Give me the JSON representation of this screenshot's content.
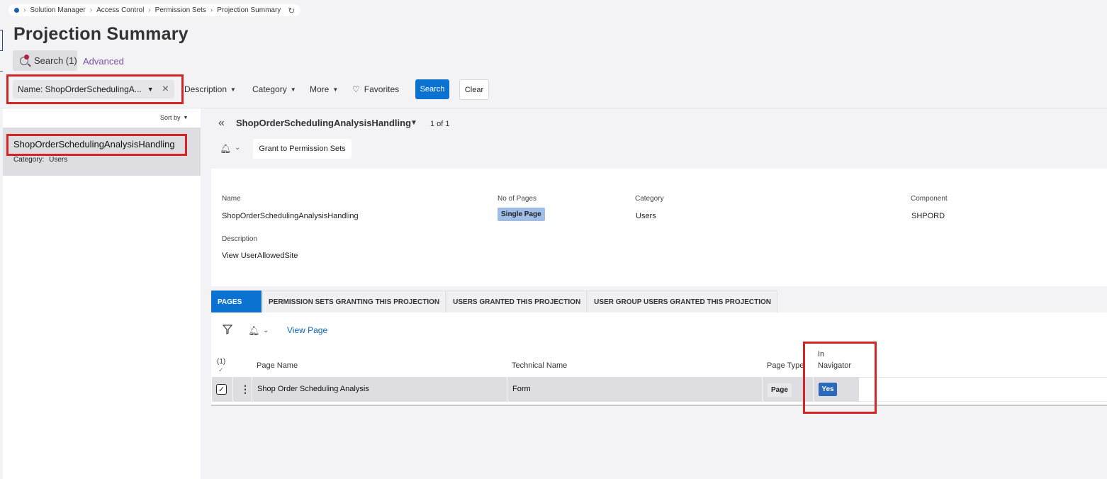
{
  "breadcrumb": {
    "items": [
      "Solution Manager",
      "Access Control",
      "Permission Sets",
      "Projection Summary"
    ]
  },
  "page_title": "Projection Summary",
  "search_tabs": {
    "search_label": "Search (1)",
    "advanced_label": "Advanced"
  },
  "filter_bar": {
    "name_chip": "Name: ShopOrderSchedulingA...",
    "description": "Description",
    "category": "Category",
    "more": "More",
    "favorites": "Favorites",
    "search_button": "Search",
    "clear_button": "Clear"
  },
  "list": {
    "sort_by": "Sort by",
    "items": [
      {
        "title": "ShopOrderSchedulingAnalysisHandling",
        "category_label": "Category:",
        "category_value": "Users"
      }
    ]
  },
  "detail": {
    "title": "ShopOrderSchedulingAnalysisHandling",
    "counter": "1 of 1",
    "grant_button": "Grant to Permission Sets",
    "fields": {
      "name_label": "Name",
      "name_value": "ShopOrderSchedulingAnalysisHandling",
      "pages_label": "No of Pages",
      "pages_value": "Single Page",
      "category_label": "Category",
      "category_value": "Users",
      "component_label": "Component",
      "component_value": "SHPORD",
      "description_label": "Description",
      "description_value": "View UserAllowedSite"
    }
  },
  "tabs": [
    "PAGES",
    "PERMISSION SETS GRANTING THIS PROJECTION",
    "USERS GRANTED THIS PROJECTION",
    "USER GROUP USERS GRANTED THIS PROJECTION"
  ],
  "grid": {
    "view_page": "View Page",
    "selection_count": "(1)",
    "columns": {
      "page_name": "Page Name",
      "technical_name": "Technical Name",
      "page_type": "Page Type",
      "in_navigator_line1": "In",
      "in_navigator_line2": "Navigator"
    },
    "rows": [
      {
        "page_name": "Shop Order Scheduling Analysis",
        "technical_name": "Form",
        "page_type": "Page",
        "in_navigator": "Yes"
      }
    ]
  },
  "colors": {
    "primary": "#0b72d1",
    "highlight_box": "#d42424",
    "yes_badge": "#2b69bb",
    "pages_badge": "#9fbde6"
  }
}
